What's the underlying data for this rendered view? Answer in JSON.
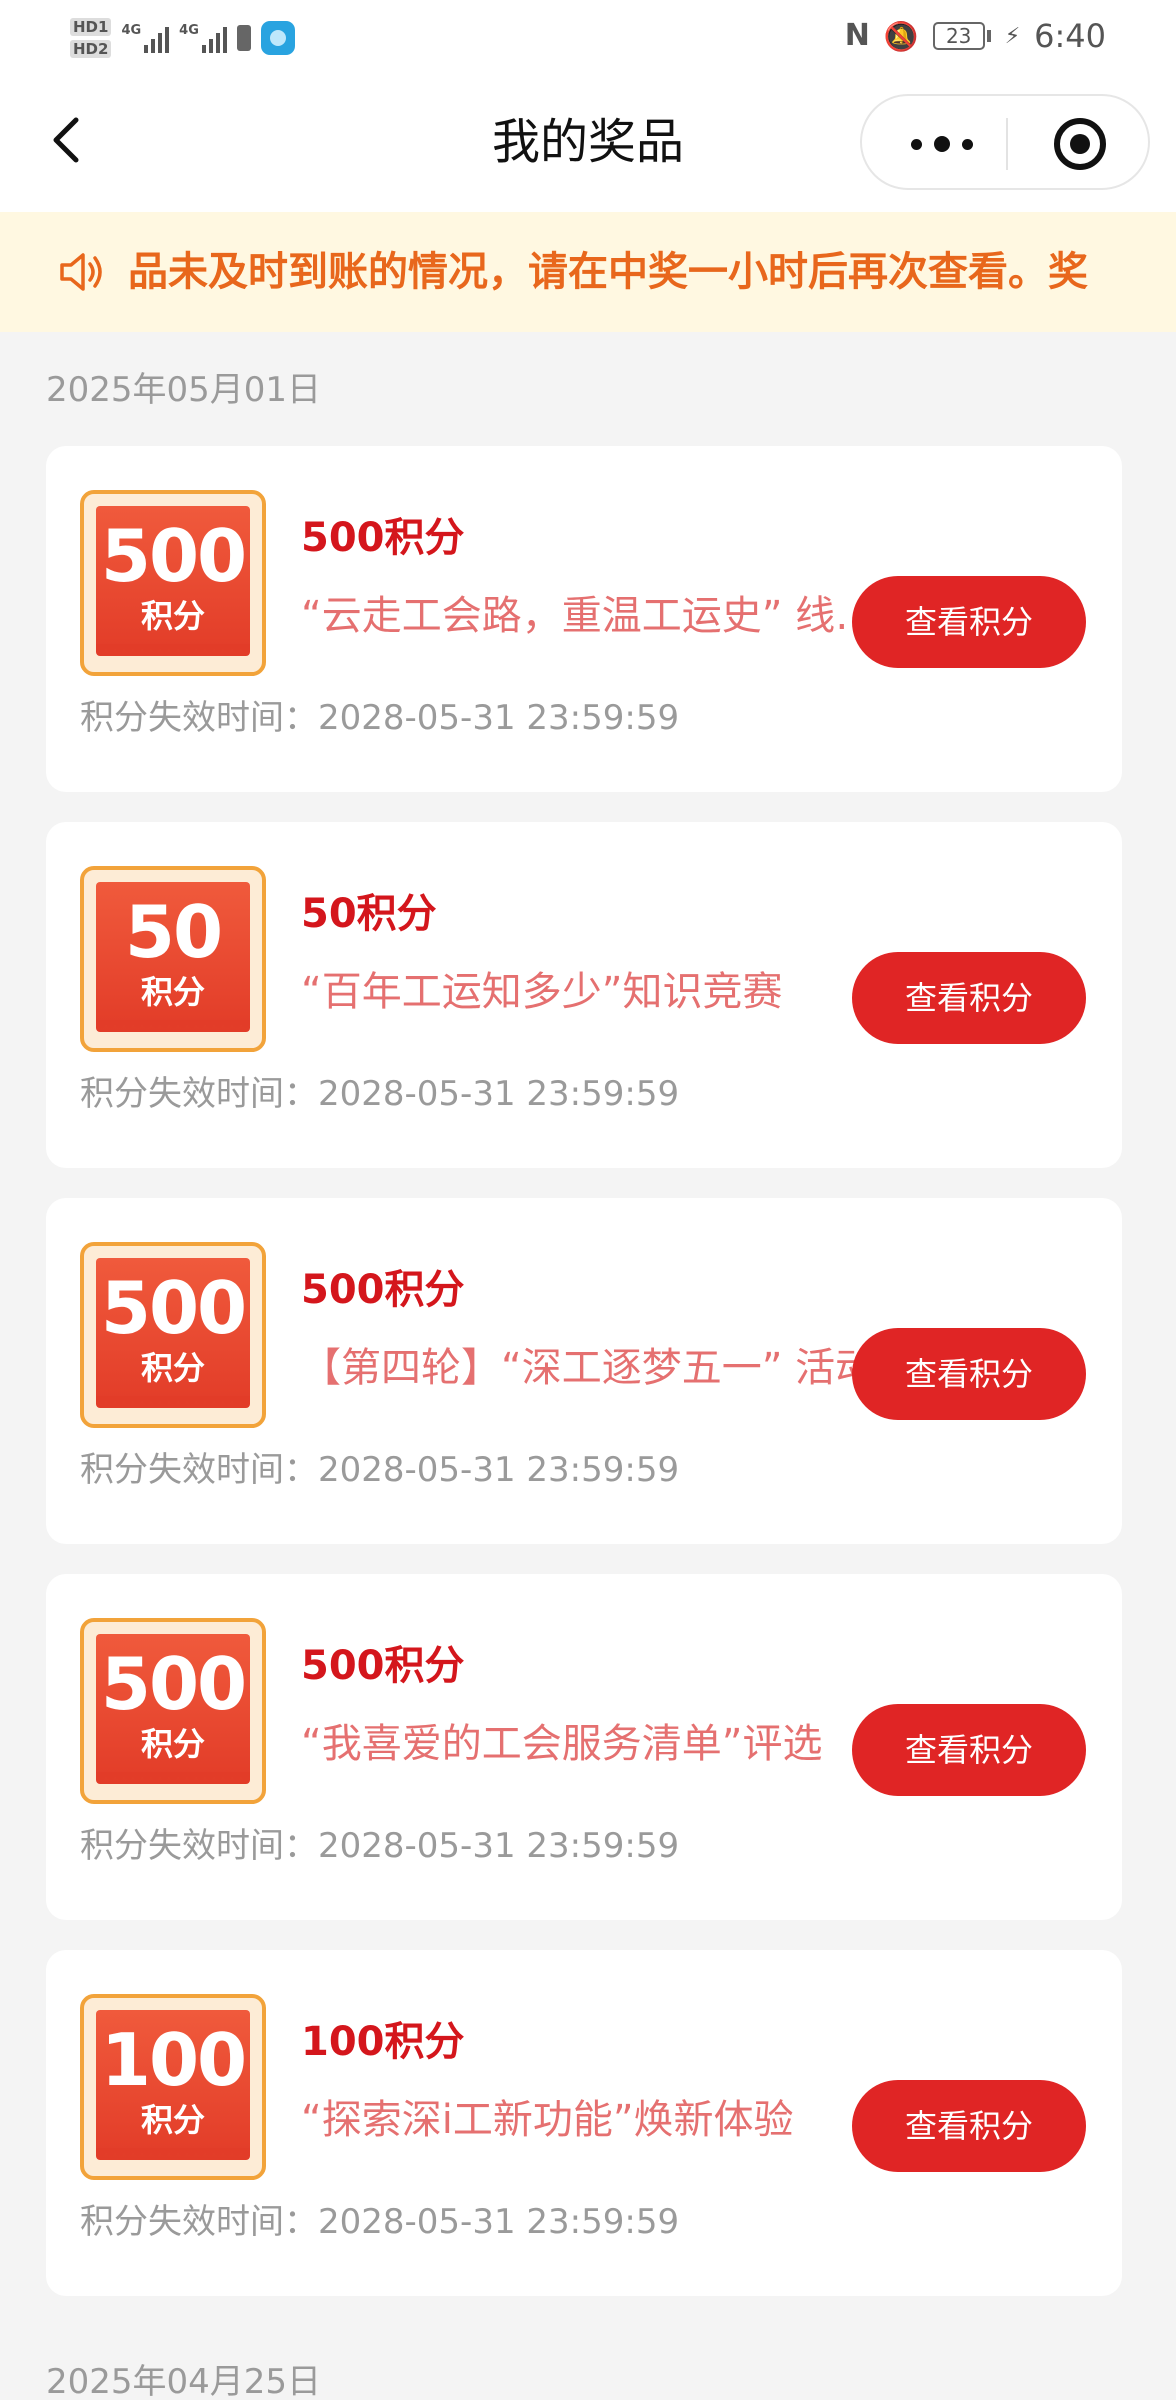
{
  "status_bar": {
    "hd1": "HD1",
    "hd2": "HD2",
    "sim1": "4G",
    "sim2": "4G",
    "battery": "23",
    "time": "6:40"
  },
  "header": {
    "title": "我的奖品"
  },
  "notice": {
    "text": "品未及时到账的情况，请在中奖一小时后再次查看。奖"
  },
  "groups": [
    {
      "date": "2025年05月01日",
      "items": [
        {
          "badge_value": "500",
          "badge_unit": "积分",
          "title": "500积分",
          "description": "“云走工会路，重温工运史” 线上答题",
          "button": "查看积分",
          "expire_label": "积分失效时间：",
          "expire_time": "2028-05-31 23:59:59"
        },
        {
          "badge_value": "50",
          "badge_unit": "积分",
          "title": "50积分",
          "description": "“百年工运知多少”知识竞赛",
          "button": "查看积分",
          "expire_label": "积分失效时间：",
          "expire_time": "2028-05-31 23:59:59"
        },
        {
          "badge_value": "500",
          "badge_unit": "积分",
          "title": "500积分",
          "description": "【第四轮】“深工逐梦五一” 活动",
          "button": "查看积分",
          "expire_label": "积分失效时间：",
          "expire_time": "2028-05-31 23:59:59"
        },
        {
          "badge_value": "500",
          "badge_unit": "积分",
          "title": "500积分",
          "description": "“我喜爱的工会服务清单”评选",
          "button": "查看积分",
          "expire_label": "积分失效时间：",
          "expire_time": "2028-05-31 23:59:59"
        },
        {
          "badge_value": "100",
          "badge_unit": "积分",
          "title": "100积分",
          "description": "“探索深i工新功能”焕新体验",
          "button": "查看积分",
          "expire_label": "积分失效时间：",
          "expire_time": "2028-05-31 23:59:59"
        }
      ]
    },
    {
      "date": "2025年04月25日",
      "items": []
    }
  ],
  "colors": {
    "accent_red": "#e02525",
    "title_red": "#d4161c",
    "notice_orange": "#e8671c",
    "notice_bg": "#fff8e1"
  },
  "icons": [
    "back-icon",
    "more-icon",
    "target-icon",
    "speaker-icon"
  ]
}
